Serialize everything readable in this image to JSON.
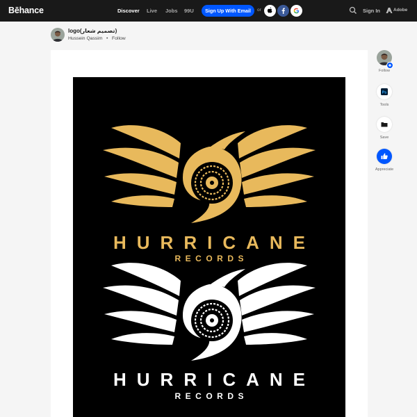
{
  "header": {
    "logo": "Bēhance",
    "nav": [
      "Discover",
      "Live",
      "Jobs",
      "99U"
    ],
    "signup": "Sign Up With Email",
    "or": "or",
    "signin": "Sign In",
    "adobe": "Adobe"
  },
  "project": {
    "title": "logo(تصميم شعار)",
    "owner": "Hussein Qassim",
    "follow": "Follow"
  },
  "artwork": {
    "logo_top": {
      "title": "HURRICANE",
      "subtitle": "RECORDS"
    },
    "logo_bottom": {
      "title": "HURRICANE",
      "subtitle": "RECORDS"
    }
  },
  "rail": {
    "follow": "Follow",
    "tools": "Tools",
    "save": "Save",
    "appreciate": "Appreciate"
  },
  "colors": {
    "topbar": "#191919",
    "accent": "#0057ff",
    "gold": "#e8b95c",
    "artwork_bg": "#000000"
  }
}
